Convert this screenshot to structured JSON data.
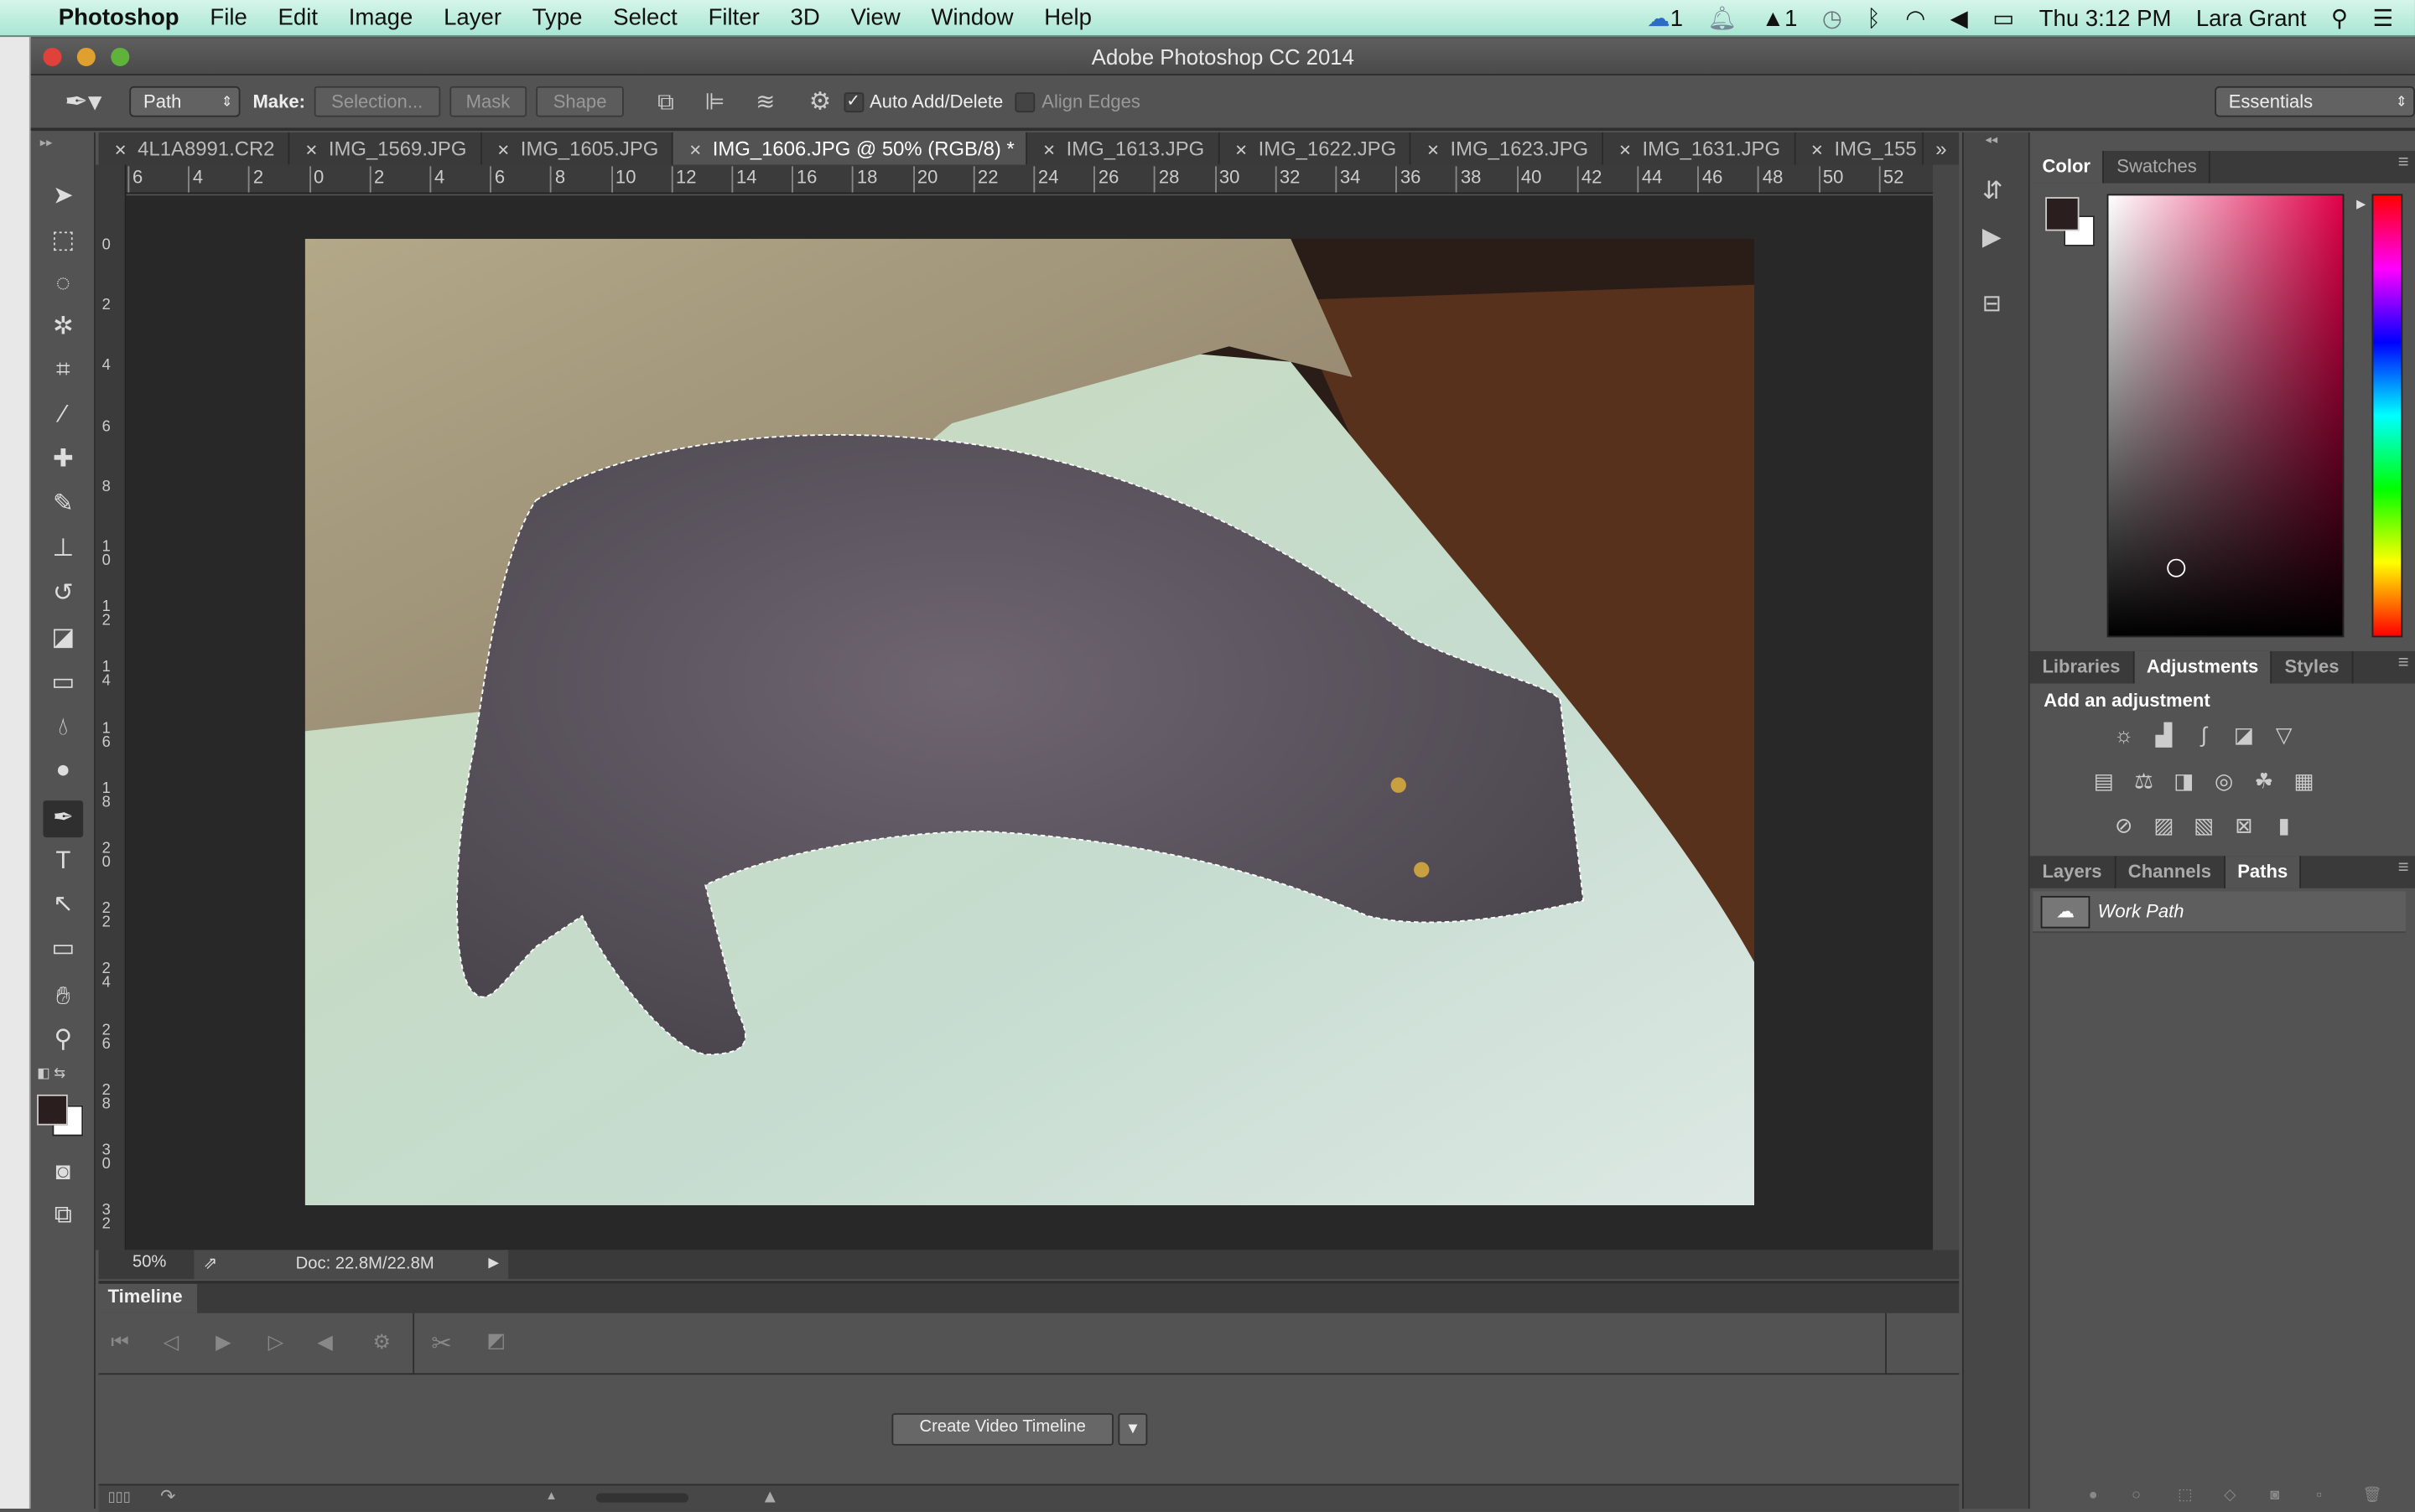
{
  "menubar": {
    "app": "Photoshop",
    "items": [
      "File",
      "Edit",
      "Image",
      "Layer",
      "Type",
      "Select",
      "Filter",
      "3D",
      "View",
      "Window",
      "Help"
    ],
    "badge1": "1",
    "badge2": "1",
    "clock": "Thu 3:12 PM",
    "user": "Lara Grant"
  },
  "window": {
    "title": "Adobe Photoshop CC 2014"
  },
  "options": {
    "mode": "Path",
    "make_label": "Make:",
    "selection": "Selection...",
    "mask": "Mask",
    "shape": "Shape",
    "auto_add_delete": "Auto Add/Delete",
    "auto_checked": true,
    "align_edges": "Align Edges",
    "align_checked": false,
    "workspace": "Essentials"
  },
  "tabs": [
    {
      "label": "4L1A8991.CR2"
    },
    {
      "label": "IMG_1569.JPG"
    },
    {
      "label": "IMG_1605.JPG"
    },
    {
      "label": "IMG_1606.JPG @ 50% (RGB/8) *",
      "active": true
    },
    {
      "label": "IMG_1613.JPG"
    },
    {
      "label": "IMG_1622.JPG"
    },
    {
      "label": "IMG_1623.JPG"
    },
    {
      "label": "IMG_1631.JPG"
    },
    {
      "label": "IMG_155"
    }
  ],
  "rulers": {
    "h": [
      "6",
      "4",
      "2",
      "0",
      "2",
      "4",
      "6",
      "8",
      "10",
      "12",
      "14",
      "16",
      "18",
      "20",
      "22",
      "24",
      "26",
      "28",
      "30",
      "32",
      "34",
      "36",
      "38",
      "40",
      "42",
      "44",
      "46",
      "48",
      "50",
      "52"
    ],
    "v": [
      "0",
      "2",
      "4",
      "6",
      "8",
      "10",
      "12",
      "14",
      "16",
      "18",
      "20",
      "22",
      "24",
      "26",
      "28",
      "30",
      "32"
    ]
  },
  "status": {
    "zoom": "50%",
    "doc": "Doc: 22.8M/22.8M"
  },
  "timeline": {
    "title": "Timeline",
    "create_button": "Create Video Timeline"
  },
  "color_panel": {
    "tabs": [
      "Color",
      "Swatches"
    ],
    "foreground": "#2a1e1e",
    "background": "#ffffff",
    "hue": "#e0004a"
  },
  "adjustments_panel": {
    "tabs": [
      "Libraries",
      "Adjustments",
      "Styles"
    ],
    "heading": "Add an adjustment"
  },
  "layers_panel": {
    "tabs": [
      "Layers",
      "Channels",
      "Paths"
    ],
    "paths": [
      {
        "name": "Work Path"
      }
    ]
  }
}
